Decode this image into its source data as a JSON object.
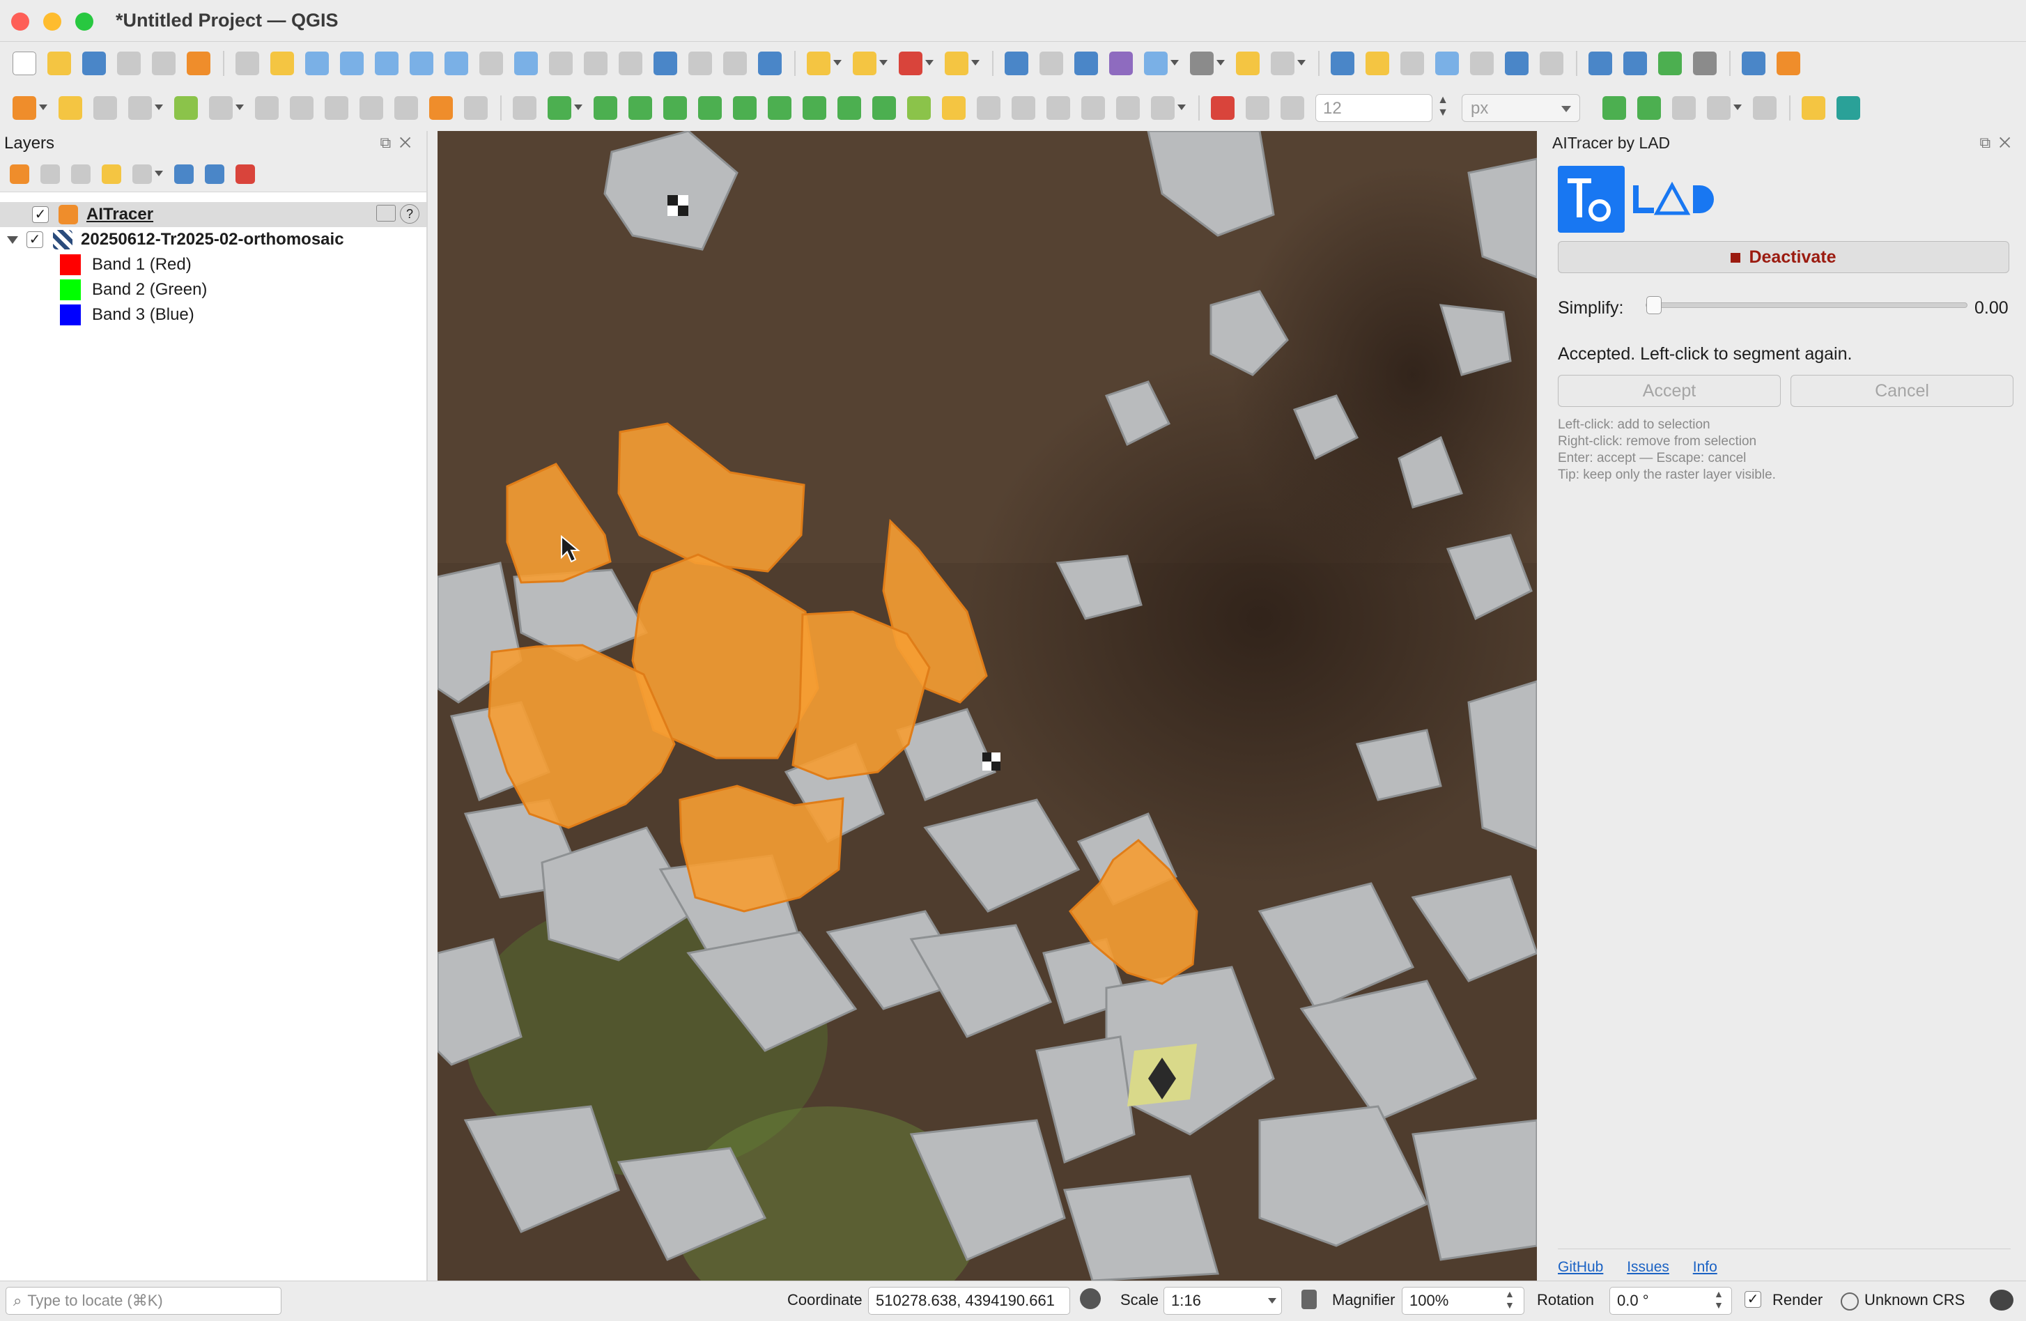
{
  "window": {
    "title": "*Untitled Project — QGIS"
  },
  "toolbar": {
    "snap_tolerance": "12",
    "snap_units": "px"
  },
  "layers": {
    "title": "Layers",
    "items": [
      {
        "name": "AITracer",
        "checked": "✓",
        "selected": true
      },
      {
        "name": "20250612-Tr2025-02-orthomosaic",
        "checked": "✓",
        "expanded": true
      },
      {
        "name": "Band 1 (Red)",
        "color": "#ff0000"
      },
      {
        "name": "Band 2 (Green)",
        "color": "#00ff00"
      },
      {
        "name": "Band 3 (Blue)",
        "color": "#0000ff"
      }
    ]
  },
  "map": {
    "segment_fill": "#f59d33",
    "background": "#4b3a2c"
  },
  "aitracer": {
    "title": "AITracer by LAD",
    "deactivate_label": "Deactivate",
    "simplify_label": "Simplify:",
    "simplify_value": "0.00",
    "status_text": "Accepted. Left-click to segment again.",
    "accept_label": "Accept",
    "cancel_label": "Cancel",
    "help_lines": [
      "Left-click: add to selection",
      "Right-click: remove from selection",
      "Enter: accept — Escape: cancel",
      "Tip: keep only the raster layer visible."
    ],
    "links": [
      "GitHub",
      "Issues",
      "Info"
    ]
  },
  "statusbar": {
    "locate_placeholder": "Type to locate (⌘K)",
    "coordinate_label": "Coordinate",
    "coordinate_value": "510278.638, 4394190.661",
    "scale_label": "Scale",
    "scale_value": "1:16",
    "magnifier_label": "Magnifier",
    "magnifier_value": "100%",
    "rotation_label": "Rotation",
    "rotation_value": "0.0 °",
    "render_label": "Render",
    "render_checked": "✓",
    "crs_label": "Unknown CRS"
  }
}
